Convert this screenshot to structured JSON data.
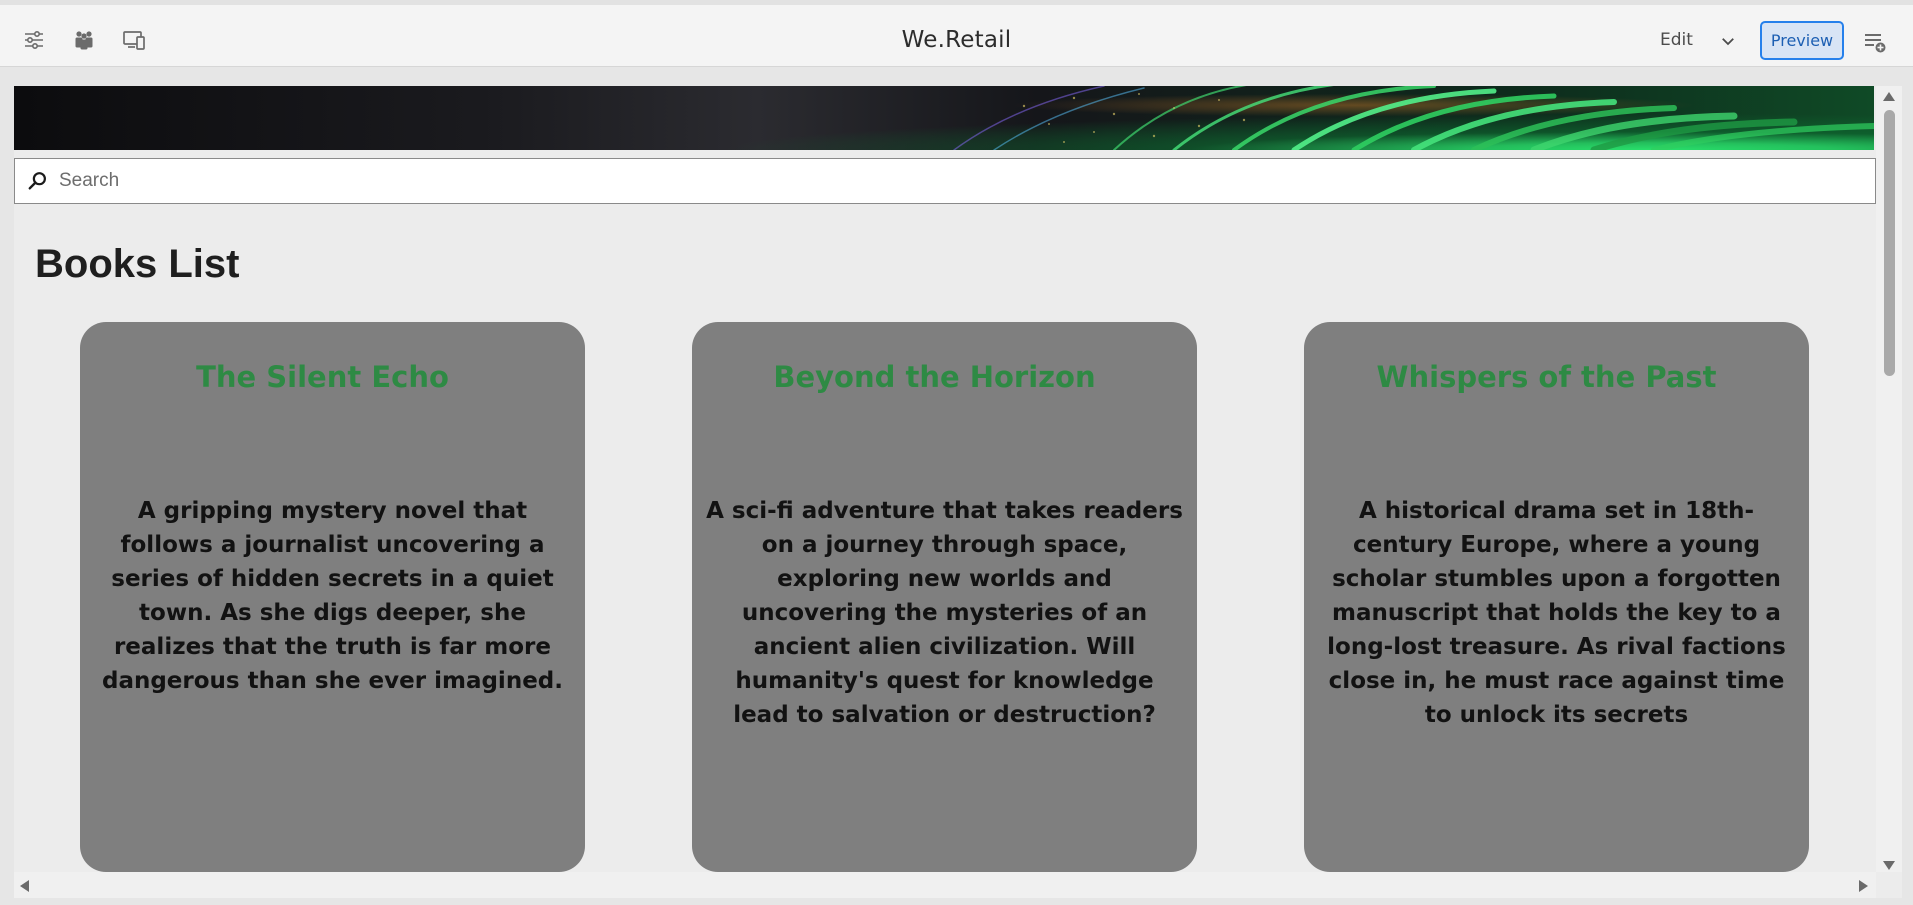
{
  "toolbar": {
    "title": "We.Retail",
    "mode_label": "Edit",
    "preview_label": "Preview",
    "icons": {
      "properties": "sliders-icon",
      "users": "users-group-icon",
      "emulator": "device-emulator-icon",
      "mode_dropdown": "chevron-down-icon",
      "annotations": "annotation-add-icon"
    }
  },
  "search": {
    "placeholder": "Search",
    "value": ""
  },
  "page": {
    "heading": "Books List"
  },
  "books": [
    {
      "title": "The Silent Echo",
      "description": "A gripping mystery novel that follows a journalist uncovering a series of hidden secrets in a quiet town. As she digs deeper, she realizes that the truth is far more dangerous than she ever imagined."
    },
    {
      "title": "Beyond the Horizon",
      "description": "A sci-fi adventure that takes readers on a journey through space, exploring new worlds and uncovering the mysteries of an ancient alien civilization. Will humanity's quest for knowledge lead to salvation or destruction?"
    },
    {
      "title": "Whispers of the Past",
      "description": "A historical drama set in 18th-century Europe, where a young scholar stumbles upon a forgotten manuscript that holds the key to a long-lost treasure. As rival factions close in, he must race against time to unlock its secrets"
    }
  ],
  "colors": {
    "card_background": "#7f7f7f",
    "card_title": "#2e8a44",
    "preview_accent": "#2680eb"
  }
}
